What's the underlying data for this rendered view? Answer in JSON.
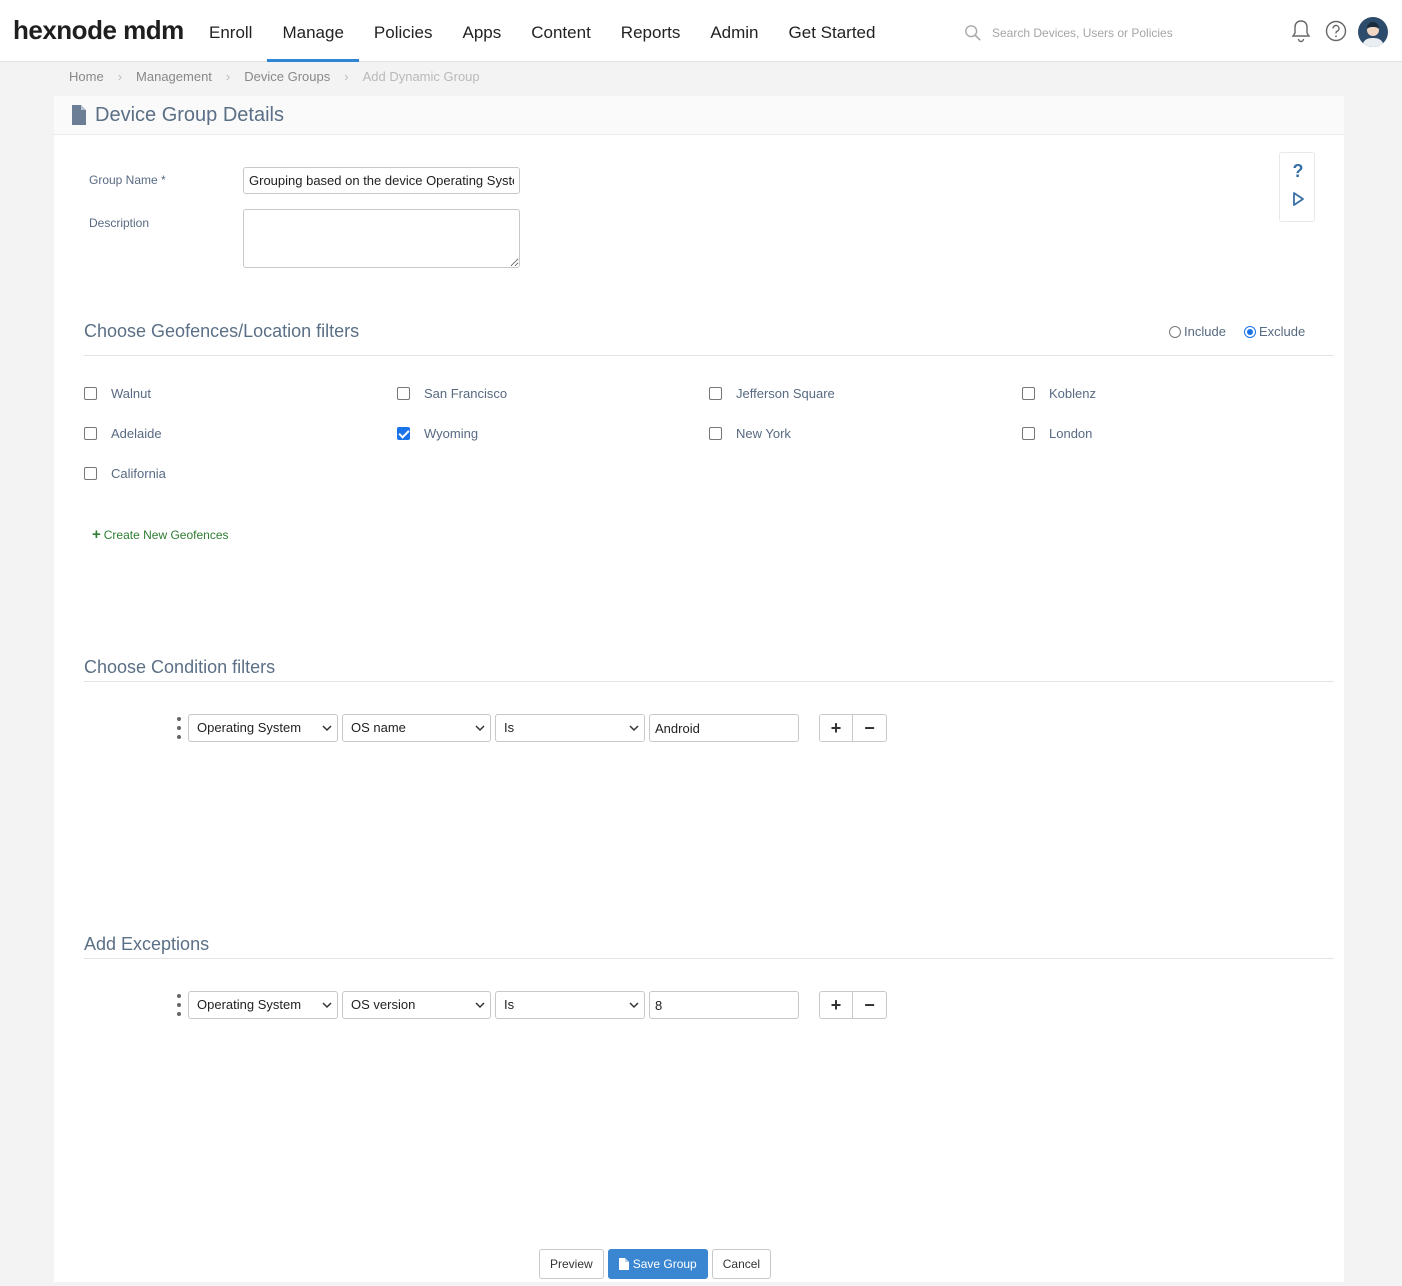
{
  "brand": {
    "logo": "hexnode mdm"
  },
  "nav": {
    "items": [
      {
        "label": "Enroll",
        "active": false
      },
      {
        "label": "Manage",
        "active": true
      },
      {
        "label": "Policies",
        "active": false
      },
      {
        "label": "Apps",
        "active": false
      },
      {
        "label": "Content",
        "active": false
      },
      {
        "label": "Reports",
        "active": false
      },
      {
        "label": "Admin",
        "active": false
      },
      {
        "label": "Get Started",
        "active": false
      }
    ]
  },
  "search": {
    "placeholder": "Search Devices, Users or Policies"
  },
  "breadcrumb": [
    "Home",
    "Management",
    "Device Groups",
    "Add Dynamic Group"
  ],
  "card": {
    "title": "Device Group Details"
  },
  "form": {
    "group_name_label": "Group Name *",
    "group_name_value": "Grouping based on the device Operating System",
    "description_label": "Description",
    "description_value": ""
  },
  "side_tools": {
    "help": "?",
    "play": "play-icon"
  },
  "geofences": {
    "title": "Choose Geofences/Location filters",
    "include_label": "Include",
    "exclude_label": "Exclude",
    "selected_mode": "Exclude",
    "items": [
      {
        "label": "Walnut",
        "checked": false
      },
      {
        "label": "San Francisco",
        "checked": false
      },
      {
        "label": "Jefferson Square",
        "checked": false
      },
      {
        "label": "Koblenz",
        "checked": false
      },
      {
        "label": "Adelaide",
        "checked": false
      },
      {
        "label": "Wyoming",
        "checked": true
      },
      {
        "label": "New York",
        "checked": false
      },
      {
        "label": "London",
        "checked": false
      },
      {
        "label": "California",
        "checked": false
      }
    ],
    "create_label": "Create New Geofences"
  },
  "conditions": {
    "title": "Choose Condition filters",
    "rows": [
      {
        "category": "Operating System",
        "field": "OS name",
        "operator": "Is",
        "value": "Android"
      }
    ]
  },
  "exceptions": {
    "title": "Add Exceptions",
    "rows": [
      {
        "category": "Operating System",
        "field": "OS version",
        "operator": "Is",
        "value": "8"
      }
    ]
  },
  "footer": {
    "preview_label": "Preview",
    "save_label": "Save Group",
    "cancel_label": "Cancel"
  },
  "colors": {
    "accent": "#2f86d4",
    "primary_button": "#3a86d0",
    "link_green": "#2e7d32",
    "title_text": "#5b6f86"
  }
}
